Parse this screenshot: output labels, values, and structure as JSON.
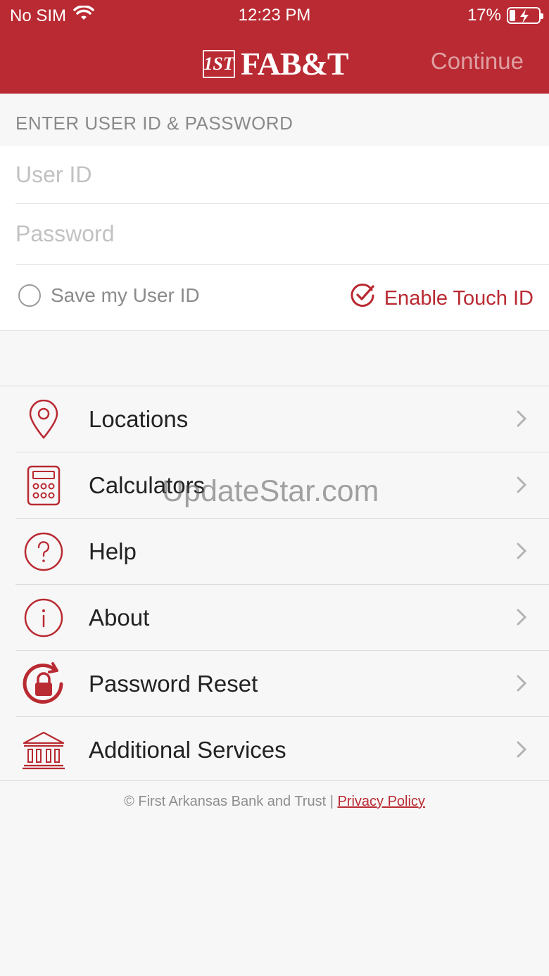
{
  "status_bar": {
    "carrier": "No SIM",
    "time": "12:23 PM",
    "battery": "17%",
    "battery_level": 0.17
  },
  "header": {
    "logo_badge": "1ST",
    "logo_text": "FAB&T",
    "continue_label": "Continue",
    "brand_color": "#b92a32"
  },
  "login": {
    "section_label": "ENTER USER ID & PASSWORD",
    "user_id_placeholder": "User ID",
    "password_placeholder": "Password",
    "save_user_id_label": "Save my User ID",
    "enable_touch_id_label": "Enable Touch ID"
  },
  "menu": {
    "items": [
      {
        "label": "Locations",
        "icon": "location-pin-icon"
      },
      {
        "label": "Calculators",
        "icon": "calculator-icon"
      },
      {
        "label": "Help",
        "icon": "question-circle-icon"
      },
      {
        "label": "About",
        "icon": "info-circle-icon"
      },
      {
        "label": "Password Reset",
        "icon": "lock-reset-icon"
      },
      {
        "label": "Additional Services",
        "icon": "bank-building-icon"
      }
    ]
  },
  "watermark": "UpdateStar.com",
  "footer": {
    "copyright": "© First Arkansas Bank and Trust |",
    "privacy_link": "Privacy Policy"
  }
}
